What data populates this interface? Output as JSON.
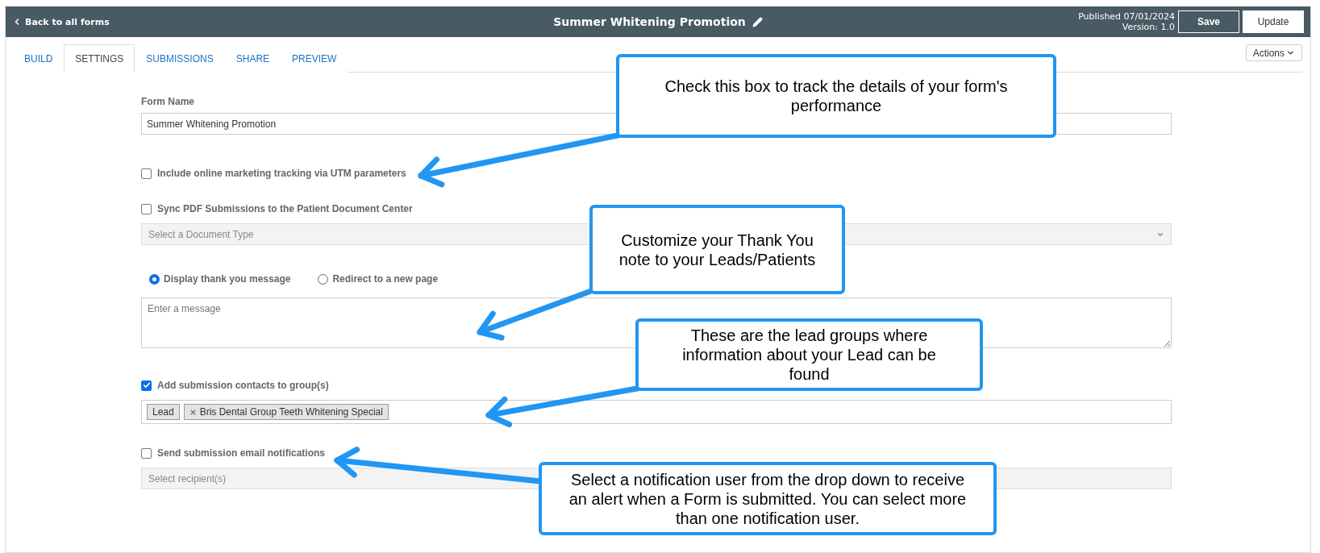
{
  "header": {
    "back_link": "Back to all forms",
    "title": "Summer Whitening Promotion",
    "published": "Published 07/01/2024",
    "version": "Version: 1.0",
    "buttons": [
      {
        "label": "Save",
        "kind": "outline"
      },
      {
        "label": "Update",
        "kind": "solid"
      }
    ]
  },
  "tabs": [
    {
      "label": "BUILD",
      "selected": false
    },
    {
      "label": "SETTINGS",
      "selected": true
    },
    {
      "label": "SUBMISSIONS",
      "selected": false
    },
    {
      "label": "SHARE",
      "selected": false
    },
    {
      "label": "PREVIEW",
      "selected": false
    }
  ],
  "actions_button": "Actions",
  "form": {
    "form_name_label": "Form Name",
    "form_name_value": "Summer Whitening Promotion",
    "utm": {
      "label": "Include online marketing tracking via UTM parameters",
      "checked": false
    },
    "sync": {
      "label": "Sync PDF Submissions to the Patient Document Center",
      "checked": false
    },
    "document_type_placeholder": "Select a Document Type",
    "radios": [
      {
        "label": "Display thank you message",
        "selected": true
      },
      {
        "label": "Redirect to a new page",
        "selected": false
      }
    ],
    "message_placeholder": "Enter a message",
    "groups": {
      "label": "Add submission contacts to group(s)",
      "checked": true
    },
    "tags": [
      {
        "label": "Lead",
        "removable": false
      },
      {
        "label": "Bris Dental Group Teeth Whitening Special",
        "removable": true
      }
    ],
    "notifications": {
      "label": "Send submission email notifications",
      "checked": false
    },
    "recipients_placeholder": "Select recipient(s)"
  },
  "callouts": [
    {
      "text": "Check this box to track the details of your form's performance"
    },
    {
      "text": "Customize your Thank You note to your Leads/Patients"
    },
    {
      "text": "These are the lead groups where information about your Lead can be found"
    },
    {
      "text": "Select a notification user from the drop down to receive an alert when a Form is submitted. You can select more than one notification user."
    }
  ]
}
